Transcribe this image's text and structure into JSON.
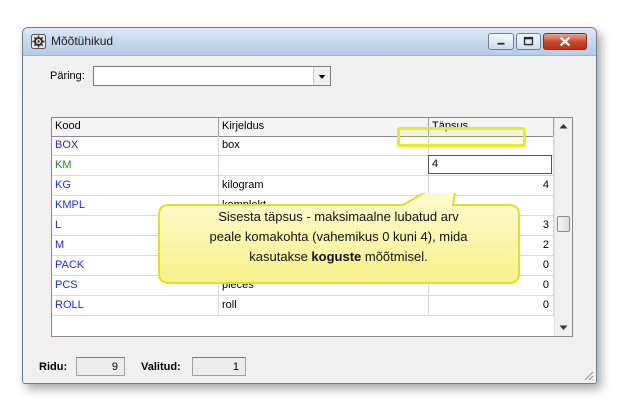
{
  "window": {
    "title": "Mõõtühikud",
    "app_icon": "gear-icon"
  },
  "query": {
    "label": "Päring:",
    "value": ""
  },
  "table": {
    "columns": [
      "Kood",
      "Kirjeldus",
      "Täpsus"
    ],
    "rows": [
      {
        "code": "BOX",
        "desc": "box",
        "prec": ""
      },
      {
        "code": "KM",
        "desc": "",
        "prec": ""
      },
      {
        "code": "KG",
        "desc": "kilogram",
        "prec": "4"
      },
      {
        "code": "KMPL",
        "desc": "komplekt",
        "prec": ""
      },
      {
        "code": "L",
        "desc": "",
        "prec": "3"
      },
      {
        "code": "M",
        "desc": "",
        "prec": "2"
      },
      {
        "code": "PACK",
        "desc": "",
        "prec": "0"
      },
      {
        "code": "PCS",
        "desc": "pieces",
        "prec": "0"
      },
      {
        "code": "ROLL",
        "desc": "roll",
        "prec": "0"
      }
    ],
    "editing_value": "4"
  },
  "callout": {
    "line1": "Sisesta täpsus - maksimaalne lubatud arv",
    "line2": "peale komakohta  (vahemikus 0 kuni 4), mida",
    "line3_pre": "kasutakse ",
    "line3_bold": "koguste",
    "line3_post": " mõõtmisel."
  },
  "status": {
    "rows_label": "Ridu:",
    "rows_value": "9",
    "selected_label": "Valitud:",
    "selected_value": "1"
  },
  "colors": {
    "code_text": "#1a2ee0",
    "active_code_text": "#1e8a1e",
    "highlight": "#e3ec2c",
    "callout_fill": "#fdf9b8"
  }
}
